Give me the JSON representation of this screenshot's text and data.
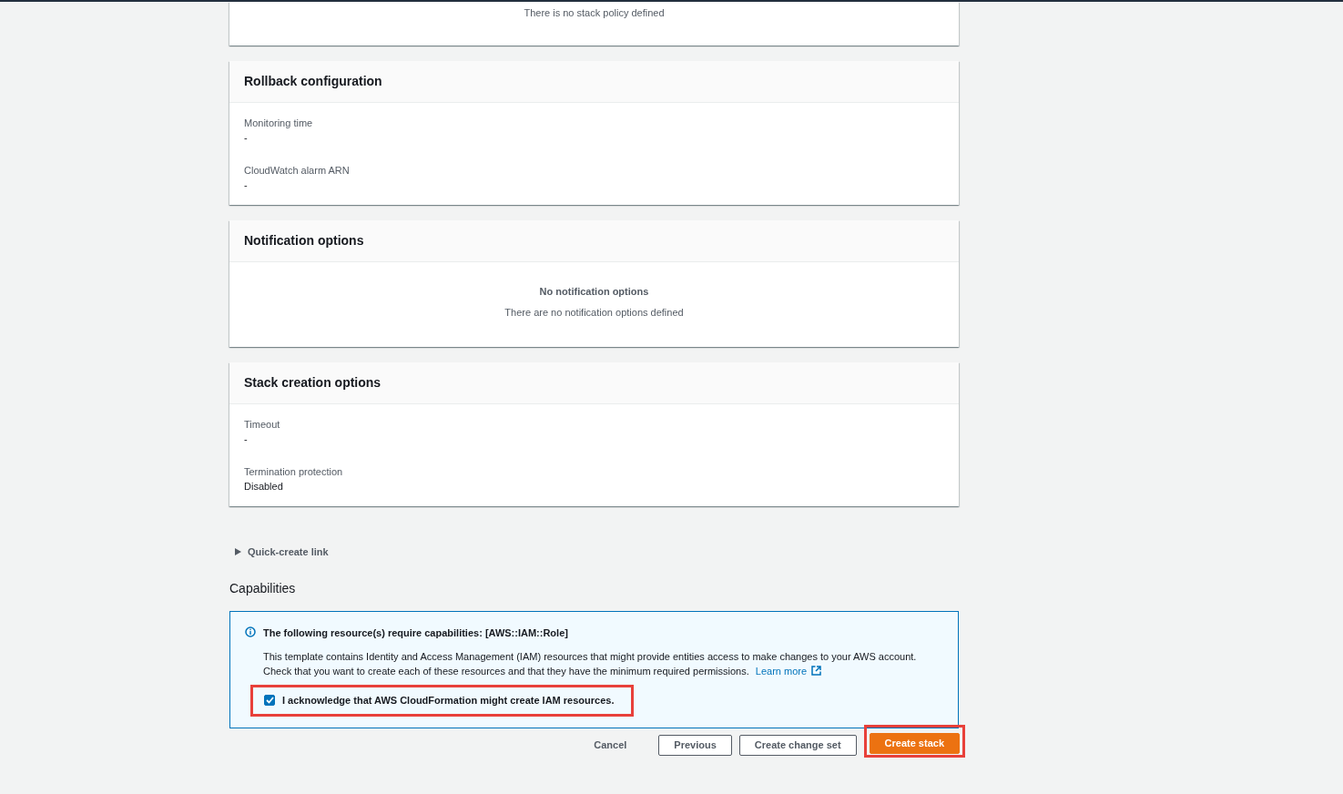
{
  "sections": [
    {
      "kind": "empty",
      "message": "There is no stack policy defined"
    },
    {
      "kind": "fields",
      "title": "Rollback configuration",
      "fields": [
        {
          "label": "Monitoring time",
          "value": "-"
        },
        {
          "label": "CloudWatch alarm ARN",
          "value": "-"
        }
      ]
    },
    {
      "kind": "empty",
      "title": "Notification options",
      "heading": "No notification options",
      "message": "There are no notification options defined"
    },
    {
      "kind": "fields",
      "title": "Stack creation options",
      "fields": [
        {
          "label": "Timeout",
          "value": "-"
        },
        {
          "label": "Termination protection",
          "value": "Disabled"
        }
      ]
    }
  ],
  "expander": {
    "label": "Quick-create link",
    "expanded": false
  },
  "capabilities": {
    "heading": "Capabilities",
    "alert": {
      "title": "The following resource(s) require capabilities: [AWS::IAM::Role]",
      "body": "This template contains Identity and Access Management (IAM) resources that might provide entities access to make changes to your AWS account. Check that you want to create each of these resources and that they have the minimum required permissions.",
      "link": "Learn more"
    },
    "checkbox": {
      "label": "I acknowledge that AWS CloudFormation might create IAM resources.",
      "checked": true,
      "highlighted": true
    }
  },
  "buttons": [
    {
      "label": "Cancel",
      "kind": "link",
      "highlighted": false
    },
    {
      "label": "Previous",
      "kind": "normal",
      "highlighted": false
    },
    {
      "label": "Create change set",
      "kind": "normal",
      "highlighted": false
    },
    {
      "label": "Create stack",
      "kind": "primary",
      "highlighted": true
    }
  ]
}
